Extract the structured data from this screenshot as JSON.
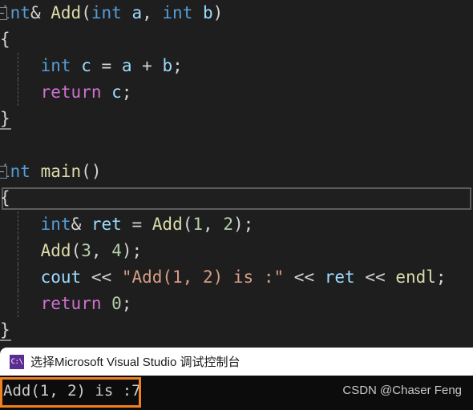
{
  "editor": {
    "background": "#1e1e1e",
    "lines": [
      {
        "id": "line-1",
        "indent": 0,
        "collapse": true,
        "text": "int& Add(int a, int b)"
      },
      {
        "id": "line-2",
        "indent": 0,
        "collapse": false,
        "text": "{"
      },
      {
        "id": "line-3",
        "indent": 1,
        "collapse": false,
        "text": "    int c = a + b;"
      },
      {
        "id": "line-4",
        "indent": 1,
        "collapse": false,
        "text": "    return c;"
      },
      {
        "id": "line-5",
        "indent": 0,
        "collapse": false,
        "text": "}"
      },
      {
        "id": "line-6",
        "indent": 0,
        "collapse": false,
        "text": ""
      },
      {
        "id": "line-7",
        "indent": 0,
        "collapse": true,
        "text": "int main()"
      },
      {
        "id": "line-8",
        "indent": 0,
        "collapse": false,
        "text": "{",
        "current": true
      },
      {
        "id": "line-9",
        "indent": 1,
        "collapse": false,
        "text": "    int& ret = Add(1, 2);"
      },
      {
        "id": "line-10",
        "indent": 1,
        "collapse": false,
        "text": "    Add(3, 4);"
      },
      {
        "id": "line-11",
        "indent": 1,
        "collapse": false,
        "text": "    cout << \"Add(1, 2) is :\" << ret << endl;"
      },
      {
        "id": "line-12",
        "indent": 1,
        "collapse": false,
        "text": "    return 0;"
      },
      {
        "id": "line-13",
        "indent": 0,
        "collapse": false,
        "text": "}"
      }
    ],
    "colors": {
      "keyword": "#569cd6",
      "control_keyword": "#d070d0",
      "function": "#dcdcaa",
      "variable": "#9cdcfe",
      "number": "#b5cea8",
      "string": "#d69d85",
      "punctuation": "#d4d4d4",
      "parameter": "#9a9a9a"
    }
  },
  "console": {
    "icon": "console-app-icon",
    "icon_glyph": "C:\\",
    "icon_color": "#5c2d91",
    "title": "选择Microsoft Visual Studio 调试控制台",
    "output": "Add(1, 2) is :7",
    "highlight_color": "#f08020",
    "watermark": "CSDN @Chaser Feng"
  }
}
